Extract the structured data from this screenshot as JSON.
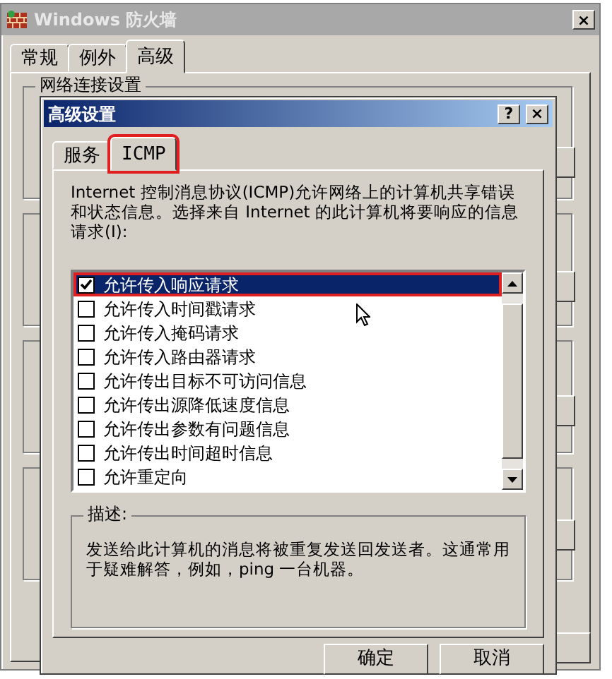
{
  "main_window": {
    "title": "Windows 防火墙",
    "close": "×",
    "group_title": "网络连接设置",
    "tabs": [
      {
        "label": "常规",
        "selected": false
      },
      {
        "label": "例外",
        "selected": false
      },
      {
        "label": "高级",
        "selected": true
      }
    ]
  },
  "dialog": {
    "title": "高级设置",
    "help": "?",
    "close": "×",
    "tabs": [
      {
        "label": "服务",
        "selected": false,
        "highlighted": false
      },
      {
        "label": "ICMP",
        "selected": true,
        "highlighted": true
      }
    ],
    "intro": "Internet 控制消息协议(ICMP)允许网络上的计算机共享错误和状态信息。选择来自 Internet 的此计算机将要响应的信息请求(I):",
    "items": [
      {
        "label": "允许传入响应请求",
        "checked": true,
        "selected": true,
        "highlighted": true
      },
      {
        "label": "允许传入时间戳请求",
        "checked": false,
        "selected": false,
        "highlighted": false
      },
      {
        "label": "允许传入掩码请求",
        "checked": false,
        "selected": false,
        "highlighted": false
      },
      {
        "label": "允许传入路由器请求",
        "checked": false,
        "selected": false,
        "highlighted": false
      },
      {
        "label": "允许传出目标不可访问信息",
        "checked": false,
        "selected": false,
        "highlighted": false
      },
      {
        "label": "允许传出源降低速度信息",
        "checked": false,
        "selected": false,
        "highlighted": false
      },
      {
        "label": "允许传出参数有问题信息",
        "checked": false,
        "selected": false,
        "highlighted": false
      },
      {
        "label": "允许传出时间超时信息",
        "checked": false,
        "selected": false,
        "highlighted": false
      },
      {
        "label": "允许重定向",
        "checked": false,
        "selected": false,
        "highlighted": false
      }
    ],
    "description_title": "描述:",
    "description": "发送给此计算机的消息将被重复发送回发送者。这通常用于疑难解答，例如，ping 一台机器。",
    "buttons": [
      "确定",
      "取消"
    ]
  }
}
